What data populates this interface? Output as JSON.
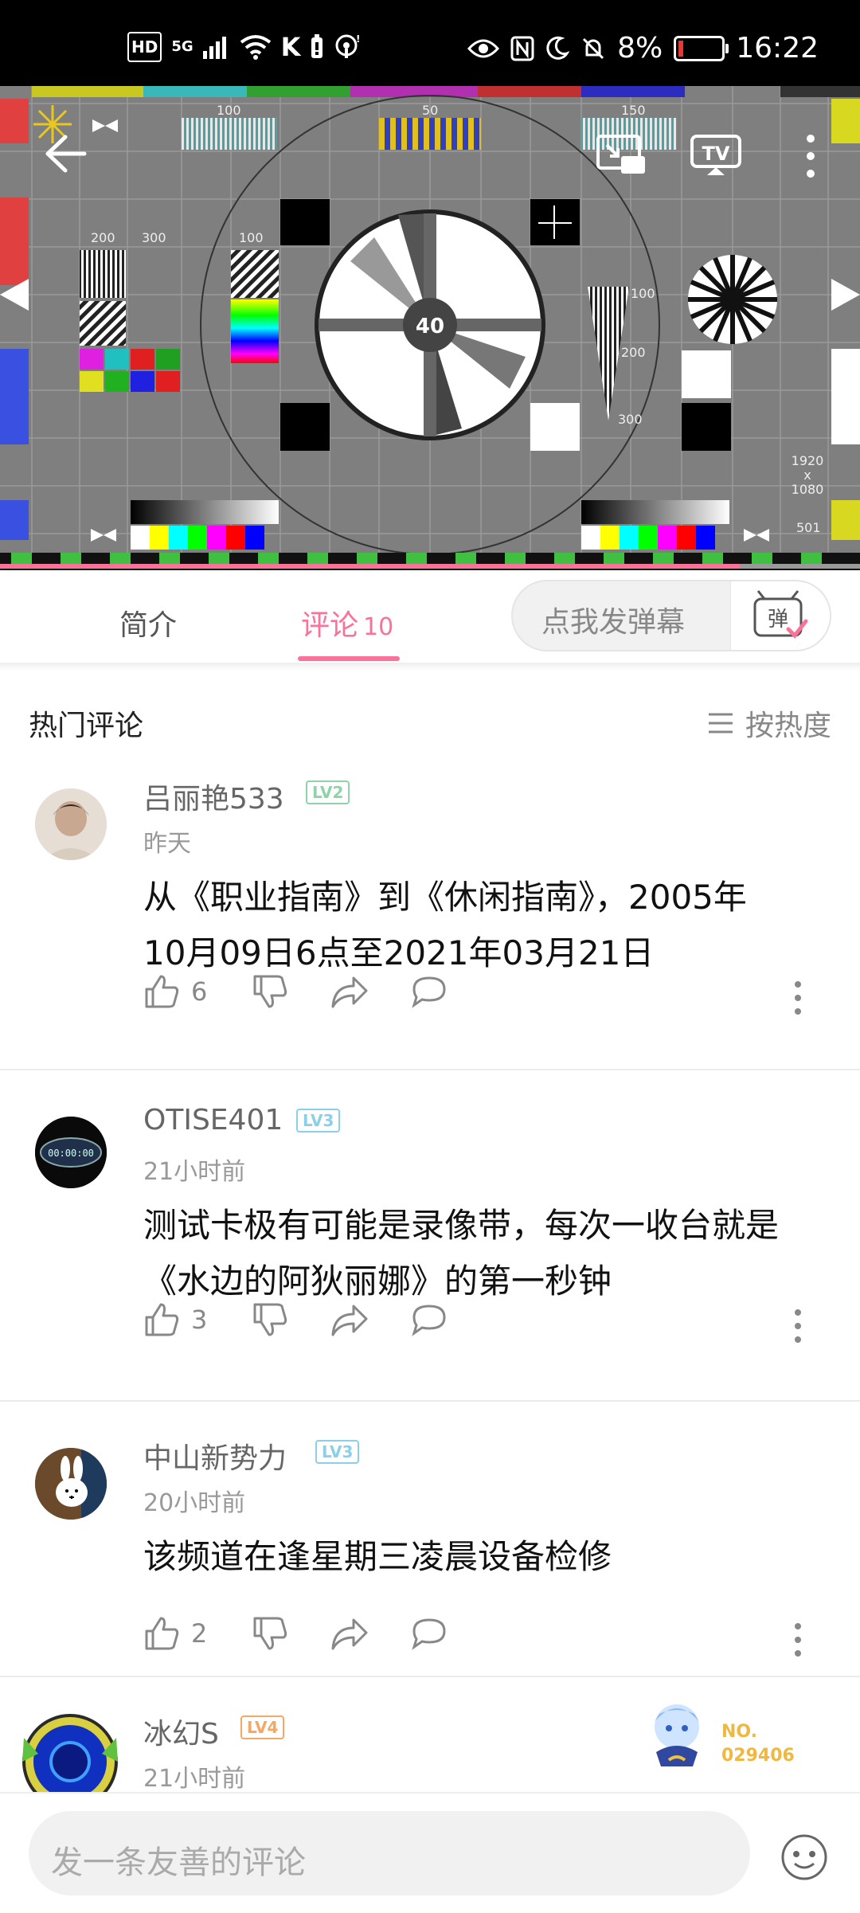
{
  "status_bar": {
    "left_icons": [
      "hd-icon",
      "5g-signal-icon",
      "wifi-icon",
      "k-icon",
      "battery-saver-icon",
      "hotspot-icon"
    ],
    "hd": "HD",
    "fiveg": "5G",
    "k": "K",
    "battery_percent": "8%",
    "time": "16:22"
  },
  "player": {
    "label_100a": "100",
    "label_50": "50",
    "label_150": "150",
    "label_200a": "200",
    "label_300a": "300",
    "label_100b": "100",
    "label_100c": "100",
    "label_200b": "200",
    "label_300b": "300",
    "clock_40": "40",
    "res_top": "1920",
    "res_x": "x",
    "res_bottom": "1080",
    "label_501": "501",
    "progress": 0.86
  },
  "tabs": {
    "intro": "简介",
    "comments_label": "评论",
    "comments_count": "10",
    "danmaku_placeholder": "点我发弹幕",
    "danmaku_btn": "弹"
  },
  "hot": {
    "title": "热门评论",
    "sort_label": "按热度"
  },
  "comments": [
    {
      "user": "吕丽艳533",
      "level": "LV2",
      "time": "昨天",
      "line1": "从《职业指南》到《休闲指南》，2005年",
      "line2": "10月09日6点至2021年03月21日",
      "likes": "6"
    },
    {
      "user": "OTISE401",
      "level": "LV3",
      "time": "21小时前",
      "line1": "测试卡极有可能是录像带，每次一收台就是",
      "line2": "《水边的阿狄丽娜》的第一秒钟",
      "likes": "3",
      "avatar_text": "00:00:00"
    },
    {
      "user": "中山新势力",
      "level": "LV3",
      "time": "20小时前",
      "line1": "该频道在逢星期三凌晨设备检修",
      "likes": "2"
    },
    {
      "user": "冰幻S",
      "level": "LV4",
      "time": "21小时前"
    }
  ],
  "badge": {
    "no": "NO.",
    "number": "029406"
  },
  "bottom": {
    "placeholder": "发一条友善的评论"
  },
  "colors": {
    "accent": "#fb7299",
    "lv2": "#8fd3a8",
    "lv3": "#8ad0e8",
    "lv4": "#f5a765"
  }
}
